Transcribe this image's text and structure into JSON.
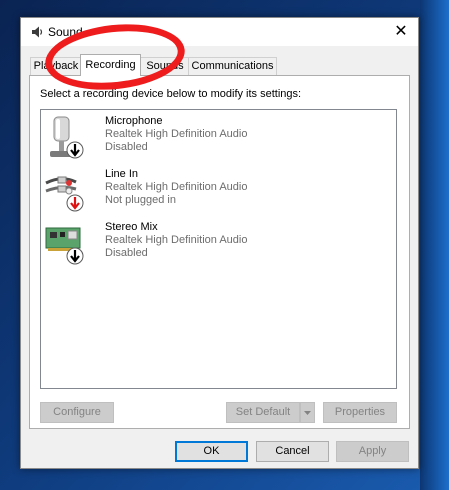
{
  "window": {
    "title": "Sound",
    "close_glyph": "✕"
  },
  "tabs": [
    {
      "label": "Playback",
      "active": false
    },
    {
      "label": "Recording",
      "active": true
    },
    {
      "label": "Sounds",
      "active": false
    },
    {
      "label": "Communications",
      "active": false
    }
  ],
  "panel": {
    "instruction": "Select a recording device below to modify its settings:"
  },
  "devices": [
    {
      "name": "Microphone",
      "driver": "Realtek High Definition Audio",
      "status": "Disabled",
      "icon": "microphone-icon",
      "badge": "down-arrow-black"
    },
    {
      "name": "Line In",
      "driver": "Realtek High Definition Audio",
      "status": "Not plugged in",
      "icon": "audio-cable-icon",
      "badge": "down-arrow-red"
    },
    {
      "name": "Stereo Mix",
      "driver": "Realtek High Definition Audio",
      "status": "Disabled",
      "icon": "sound-card-icon",
      "badge": "down-arrow-black"
    }
  ],
  "panel_buttons": {
    "configure": "Configure",
    "set_default": "Set Default",
    "properties": "Properties"
  },
  "dialog_buttons": {
    "ok": "OK",
    "cancel": "Cancel",
    "apply": "Apply"
  },
  "colors": {
    "annotation_red": "#ee1c1c",
    "focus_blue": "#0078d7",
    "desktop_blue": "#10346a"
  }
}
